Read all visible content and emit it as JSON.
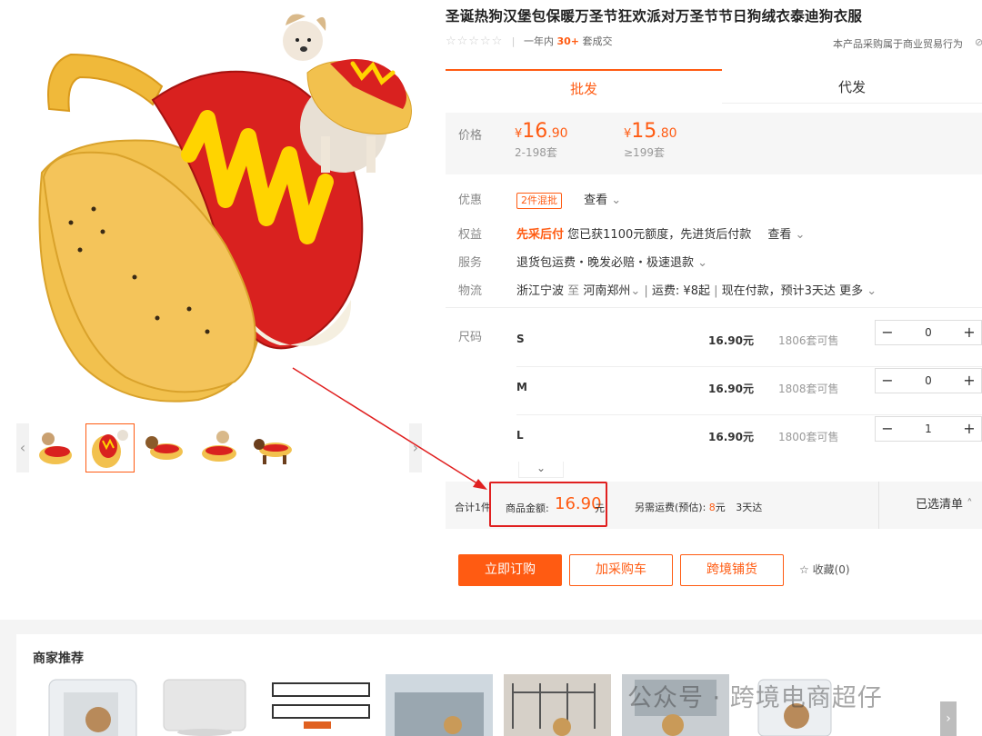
{
  "product": {
    "title": "圣诞热狗汉堡包保暖万圣节狂欢派对万圣节节日狗绒衣泰迪狗衣服",
    "stars": "☆☆☆☆☆",
    "sold_prefix": "一年内",
    "sold_count": "30+",
    "sold_suffix": "套成交",
    "notice": "本产品采购属于商业贸易行为",
    "notice_icon": "⊘"
  },
  "tabs": [
    {
      "label": "批发"
    },
    {
      "label": "代发"
    }
  ],
  "price": {
    "label": "价格",
    "tiers": [
      {
        "yen": "¥",
        "int": "16",
        "dec": ".90",
        "range": "2-198套"
      },
      {
        "yen": "¥",
        "int": "15",
        "dec": ".80",
        "range": "≥199套"
      }
    ]
  },
  "info": {
    "discount_label": "优惠",
    "discount_tag": "2件混批",
    "discount_link": "查看",
    "rights_label": "权益",
    "rights_highlight": "先采后付",
    "rights_text": "您已获1100元额度，先进货后付款",
    "rights_link": "查看",
    "service_label": "服务",
    "service_text": "退货包运费・晚发必赔・极速退款",
    "logistics_label": "物流",
    "logistics_from": "浙江宁波",
    "logistics_to_word": "至",
    "logistics_dest": "河南郑州",
    "logistics_fee": "运费: ¥8起",
    "logistics_eta": "现在付款，预计3天达",
    "logistics_more": "更多"
  },
  "sizes": {
    "label": "尺码",
    "rows": [
      {
        "name": "S",
        "price": "16.90元",
        "stock": "1806套可售",
        "qty": "0"
      },
      {
        "name": "M",
        "price": "16.90元",
        "stock": "1808套可售",
        "qty": "0"
      },
      {
        "name": "L",
        "price": "16.90元",
        "stock": "1800套可售",
        "qty": "1"
      }
    ],
    "minus": "−",
    "plus": "+",
    "expand": "⌄"
  },
  "total": {
    "count_text": "合计1件",
    "amount_label": "商品金额:",
    "amount_value": "16.90",
    "amount_unit": "元",
    "shipping_label": "另需运费(预估):",
    "shipping_value": "8",
    "shipping_unit": "元",
    "eta": "3天达",
    "selected_list": "已选清单",
    "highlight_color": "#e02020"
  },
  "actions": {
    "buy": "立即订购",
    "cart": "加采购车",
    "cross": "跨境铺货",
    "fav": "收藏(0)",
    "fav_icon": "☆"
  },
  "recommend": {
    "title": "商家推荐",
    "next": "›",
    "watermark": "公众号 · 跨境电商超仔"
  },
  "colors": {
    "accent": "#ff5b12",
    "red_annotation": "#e02020"
  }
}
